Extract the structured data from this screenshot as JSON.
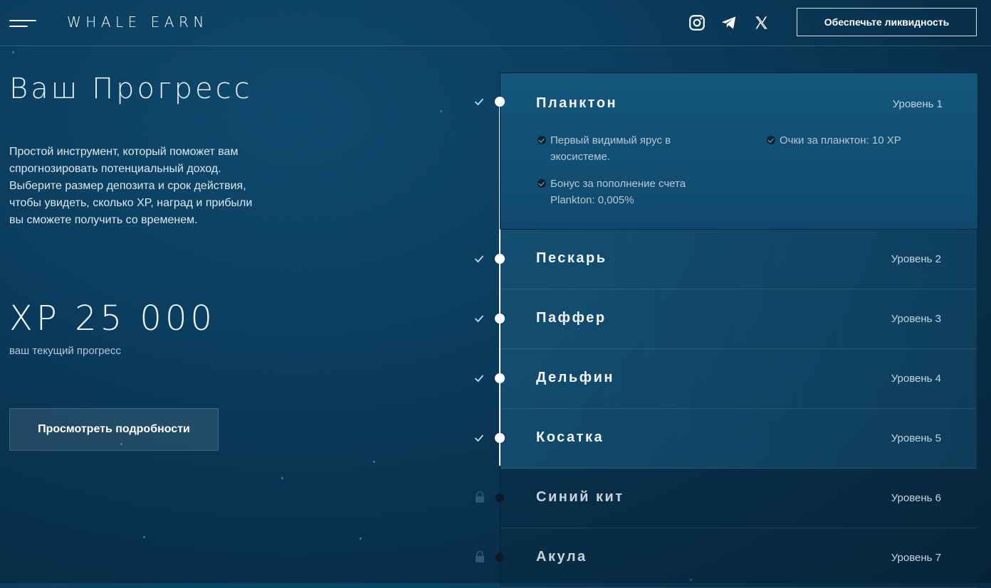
{
  "header": {
    "logo": "WHALE EARN",
    "social": [
      {
        "name": "instagram-icon"
      },
      {
        "name": "telegram-icon"
      },
      {
        "name": "x-icon"
      }
    ],
    "cta_label": "Обеспечьте ликвидность"
  },
  "progress": {
    "title": "Ваш Прогресс",
    "description": "Простой инструмент, который поможет вам спрогнозировать потенциальный доход. Выберите размер депозита и срок действия, чтобы увидеть, сколько XP, наград и прибыли вы сможете получить со временем.",
    "xp_value": "XP 25 000",
    "xp_caption": "ваш текущий прогресс",
    "details_label": "Просмотреть подробности"
  },
  "levels": [
    {
      "name": "Планктон",
      "level": "Уровень 1",
      "status": "completed",
      "expanded": true,
      "perks": [
        "Первый видимый ярус в экосистеме.",
        "Бонус за пополнение счета Plankton: 0,005%",
        "Очки за планктон: 10 XP"
      ]
    },
    {
      "name": "Пескарь",
      "level": "Уровень 2",
      "status": "completed"
    },
    {
      "name": "Паффер",
      "level": "Уровень 3",
      "status": "completed"
    },
    {
      "name": "Дельфин",
      "level": "Уровень 4",
      "status": "completed"
    },
    {
      "name": "Косатка",
      "level": "Уровень 5",
      "status": "completed"
    },
    {
      "name": "Синий кит",
      "level": "Уровень 6",
      "status": "locked"
    },
    {
      "name": "Акула",
      "level": "Уровень 7",
      "status": "locked"
    }
  ],
  "colors": {
    "background": "#0b3d5e",
    "accent_white": "#ffffff",
    "locked_marker": "#0a1a24"
  }
}
